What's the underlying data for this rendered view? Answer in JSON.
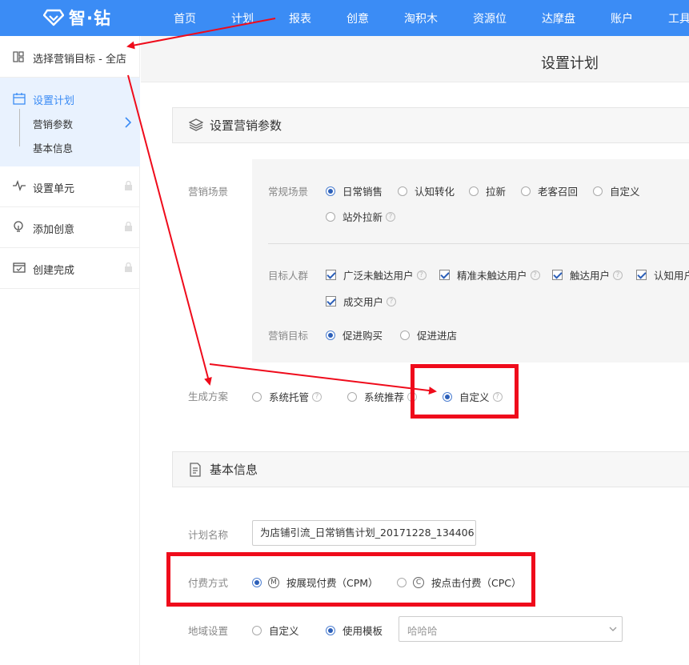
{
  "brand": {
    "logo_text": "智·钻"
  },
  "nav": [
    "首页",
    "计划",
    "报表",
    "创意",
    "淘积木",
    "资源位",
    "达摩盘",
    "账户",
    "工具"
  ],
  "sidebar": {
    "goal_label": "选择营销目标 - 全店",
    "plan_label": "设置计划",
    "plan_sub": [
      "营销参数",
      "基本信息"
    ],
    "steps": [
      "设置单元",
      "添加创意",
      "创建完成"
    ]
  },
  "page_title": "设置计划",
  "section_marketing": "设置营销参数",
  "scene": {
    "label": "营销场景",
    "regular_label": "常规场景",
    "options": [
      "日常销售",
      "认知转化",
      "拉新",
      "老客召回",
      "自定义",
      "站外拉新"
    ],
    "selected": "日常销售",
    "audience_label": "目标人群",
    "audience": [
      "广泛未触达用户",
      "精准未触达用户",
      "触达用户",
      "认知用户",
      "成交用户"
    ],
    "goal_label": "营销目标",
    "goals": [
      "促进购买",
      "促进进店"
    ],
    "goal_selected": "促进购买"
  },
  "generate": {
    "label": "生成方案",
    "options": [
      "系统托管",
      "系统推荐",
      "自定义"
    ],
    "selected": "自定义"
  },
  "section_basic": "基本信息",
  "plan_name": {
    "label": "计划名称",
    "value": "为店铺引流_日常销售计划_20171228_134406"
  },
  "payment": {
    "label": "付费方式",
    "options": [
      {
        "badge": "M",
        "text": "按展现付费（CPM）"
      },
      {
        "badge": "C",
        "text": "按点击付费（CPC）"
      }
    ],
    "selected": "按展现付费（CPM）"
  },
  "region": {
    "label": "地域设置",
    "options": [
      "自定义",
      "使用模板"
    ],
    "selected": "使用模板",
    "template_value": "哈哈哈"
  },
  "colors": {
    "nav_bg": "#3b8cf5",
    "accent": "#3b8cf5",
    "annotation": "#ef0b1b"
  },
  "icons": [
    "gem-logo-icon",
    "target-grid-icon",
    "calendar-icon",
    "chevron-right-icon",
    "pulse-icon",
    "bulb-icon",
    "finish-calendar-icon",
    "lock-icon",
    "layers-icon",
    "document-icon",
    "help-icon",
    "chevron-down-icon"
  ]
}
